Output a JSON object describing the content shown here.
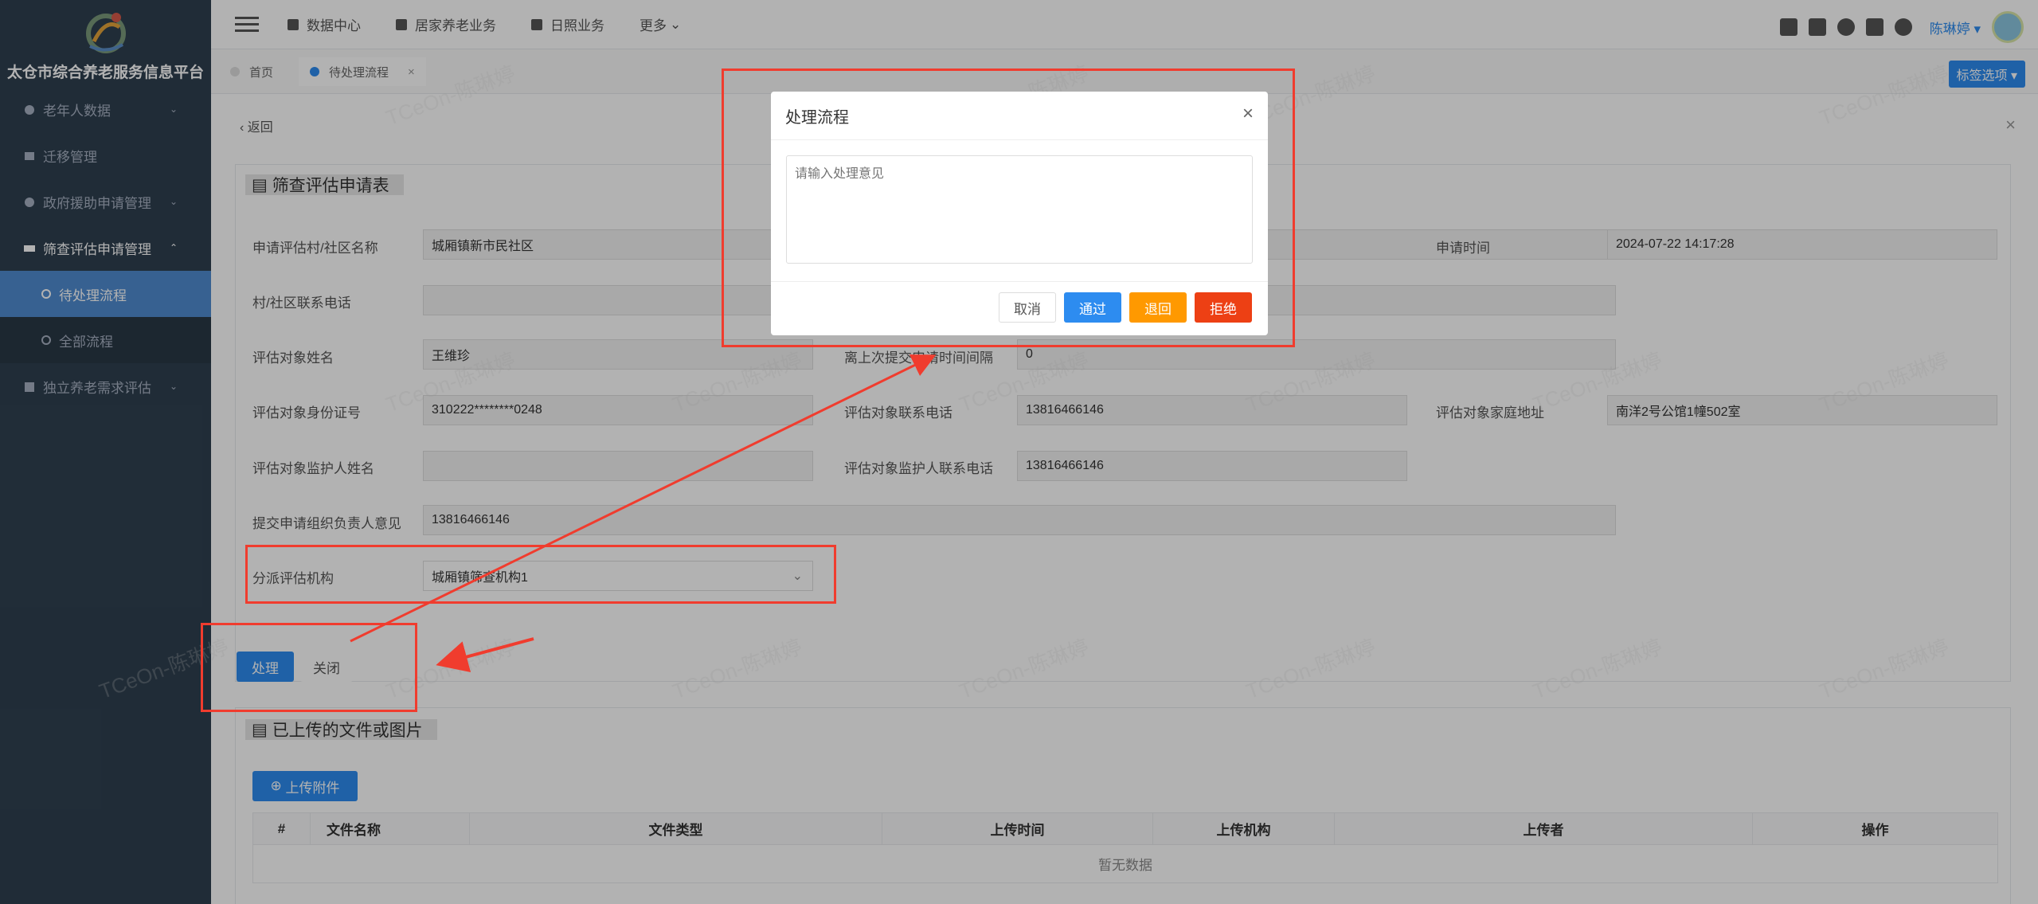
{
  "sidebar": {
    "title": "太仓市综合养老服务信息平台",
    "items": [
      {
        "label": "老年人数据",
        "icon": "elder-icon",
        "chevron": "⌄"
      },
      {
        "label": "迁移管理",
        "icon": "migrate-icon",
        "chevron": ""
      },
      {
        "label": "政府援助申请管理",
        "icon": "gov-icon",
        "chevron": "⌄"
      },
      {
        "label": "筛查评估申请管理",
        "icon": "screen-icon",
        "chevron": "⌃"
      },
      {
        "label": "待处理流程",
        "icon": "pending-icon",
        "chevron": ""
      },
      {
        "label": "全部流程",
        "icon": "all-flow-icon",
        "chevron": ""
      },
      {
        "label": "独立养老需求评估",
        "icon": "eval-icon",
        "chevron": "⌄"
      }
    ]
  },
  "topbar": {
    "nav": [
      "数据中心",
      "居家养老业务",
      "日照业务",
      "更多"
    ],
    "more_caret": "⌄",
    "user": "陈琳婷",
    "user_caret": "▾"
  },
  "tabs": {
    "items": [
      "首页",
      "待处理流程"
    ],
    "close": "×",
    "label_options": "标签选项",
    "label_caret": "▾"
  },
  "content": {
    "back": "返回",
    "close": "×",
    "section1_title": "筛查评估申请表",
    "fields": {
      "community_name_label": "申请评估村/社区名称",
      "community_name": "城厢镇新市民社区",
      "apply_time_label": "申请时间",
      "apply_time": "2024-07-22 14:17:28",
      "community_phone_label": "村/社区联系电话",
      "community_phone": "",
      "subject_name_label": "评估对象姓名",
      "subject_name": "王维珍",
      "last_interval_label": "离上次提交申请时间间隔",
      "last_interval": "0",
      "id_label": "评估对象身份证号",
      "id_value": "310222********0248",
      "phone_label": "评估对象联系电话",
      "phone": "13816466146",
      "address_label": "评估对象家庭地址",
      "address": "南洋2号公馆1幢502室",
      "guardian_name_label": "评估对象监护人姓名",
      "guardian_name": "",
      "guardian_phone_label": "评估对象监护人联系电话",
      "guardian_phone": "13816466146",
      "org_opinion_label": "提交申请组织负责人意见",
      "org_opinion": "13816466146",
      "assign_org_label": "分派评估机构",
      "assign_org": "城厢镇筛查机构1",
      "assign_caret": "⌄"
    },
    "process_button": "处理",
    "close_button": "关闭",
    "section2_title": "已上传的文件或图片",
    "upload_button": "上传附件",
    "table": {
      "headers": [
        "#",
        "文件名称",
        "文件类型",
        "上传时间",
        "上传机构",
        "上传者",
        "操作"
      ],
      "empty": "暂无数据"
    }
  },
  "dialog": {
    "title": "处理流程",
    "close": "×",
    "placeholder": "请输入处理意见",
    "cancel": "取消",
    "pass": "通过",
    "return": "退回",
    "reject": "拒绝"
  },
  "watermark": "TCeOn-陈琳婷",
  "colors": {
    "sidebar_bg": "#2f4050",
    "active_item": "#4f8bd0",
    "primary": "#2d8cf0",
    "warning": "#ff9900",
    "danger": "#ed4014",
    "annotation_red": "#f03c2e"
  }
}
